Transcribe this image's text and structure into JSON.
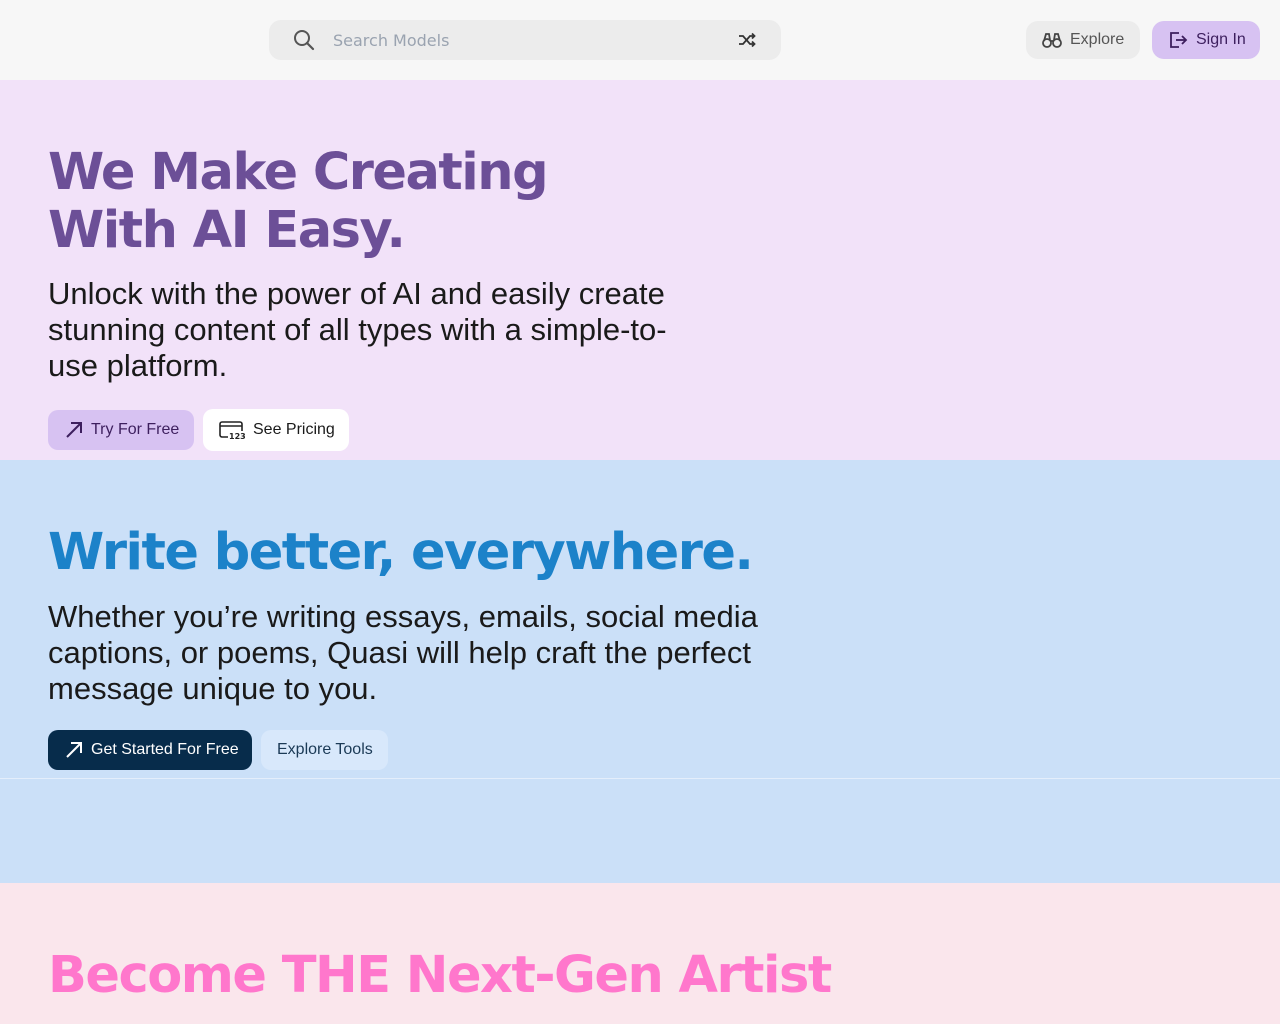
{
  "header": {
    "search_placeholder": "Search Models",
    "explore_label": "Explore",
    "signin_label": "Sign In"
  },
  "hero": {
    "title": "We Make Creating With AI Easy.",
    "lead": "Unlock with the power of AI and easily create stunning content of all types with a simple-to-use platform.",
    "try_label": "Try For Free",
    "pricing_label": "See Pricing"
  },
  "write": {
    "title": "Write better, everywhere.",
    "lead": "Whether you’re writing essays, emails, social media captions, or poems, Quasi will help craft the perfect message unique to you.",
    "start_label": "Get Started For Free",
    "tools_label": "Explore Tools"
  },
  "artist": {
    "title": "Become THE Next-Gen Artist"
  },
  "colors": {
    "hero_bg": "#f2e2f9",
    "hero_title": "#6c4f97",
    "write_bg": "#cbe0f8",
    "write_title": "#1c82c9",
    "artist_bg": "#fae6ec",
    "artist_title": "#ff77cc",
    "accent_purple": "#d7c2f2",
    "dark_navy": "#072c4b"
  },
  "icons": {
    "search": "search-icon",
    "shuffle": "shuffle-icon",
    "explore": "binoculars-icon",
    "signin": "sign-in-icon",
    "try": "arrow-up-right-icon",
    "pricing": "credit-card-123-icon",
    "start": "arrow-up-right-icon"
  }
}
